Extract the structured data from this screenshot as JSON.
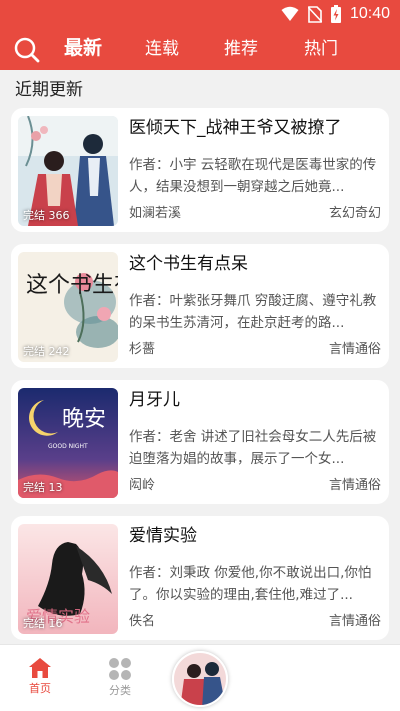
{
  "status_bar": {
    "time": "10:40",
    "icons": [
      "wifi-icon",
      "no-sim-icon",
      "battery-charging-icon"
    ]
  },
  "header": {
    "search_icon": "search-icon",
    "tabs": [
      {
        "label": "最新",
        "active": true
      },
      {
        "label": "连载",
        "active": false
      },
      {
        "label": "推荐",
        "active": false
      },
      {
        "label": "热门",
        "active": false
      }
    ]
  },
  "section": {
    "title": "近期更新"
  },
  "books": [
    {
      "title": "医倾天下_战神王爷又被撩了",
      "description": "作者：小宇 云轻歌在现代是医毒世家的传人，结果没想到一朝穿越之后她竟...",
      "author": "如澜若溪",
      "genre": "玄幻奇幻",
      "badge": "完结 366"
    },
    {
      "title": "这个书生有点呆",
      "description": "作者：叶紫张牙舞爪 穷酸迂腐、遵守礼教的呆书生苏清河，在赴京赶考的路...",
      "author": "杉薔",
      "genre": "言情通俗",
      "badge": "完结 242",
      "cover_text": "这个书生有点呆"
    },
    {
      "title": "月牙儿",
      "description": "作者：老舍 讲述了旧社会母女二人先后被迫堕落为娼的故事，展示了一个女...",
      "author": "闳岭",
      "genre": "言情通俗",
      "badge": "完结 13",
      "cover_text": "晚安",
      "cover_subtext": "GOOD NIGHT"
    },
    {
      "title": "爱情实验",
      "description": "作者：刘秉政 你爱他,你不敢说出口,你怕了。你以实验的理由,套住他,难过了...",
      "author": "佚名",
      "genre": "言情通俗",
      "badge": "完结 16",
      "cover_text": "爱情实验"
    }
  ],
  "bottom_nav": {
    "items": [
      {
        "label": "首页",
        "icon": "home-icon",
        "active": true
      },
      {
        "label": "分类",
        "icon": "grid-icon",
        "active": false
      }
    ],
    "avatar_icon": "avatar"
  },
  "colors": {
    "brand": "#e84a3f",
    "background": "#f1f1f1",
    "card": "#ffffff",
    "inactive": "#9a9a9a"
  }
}
